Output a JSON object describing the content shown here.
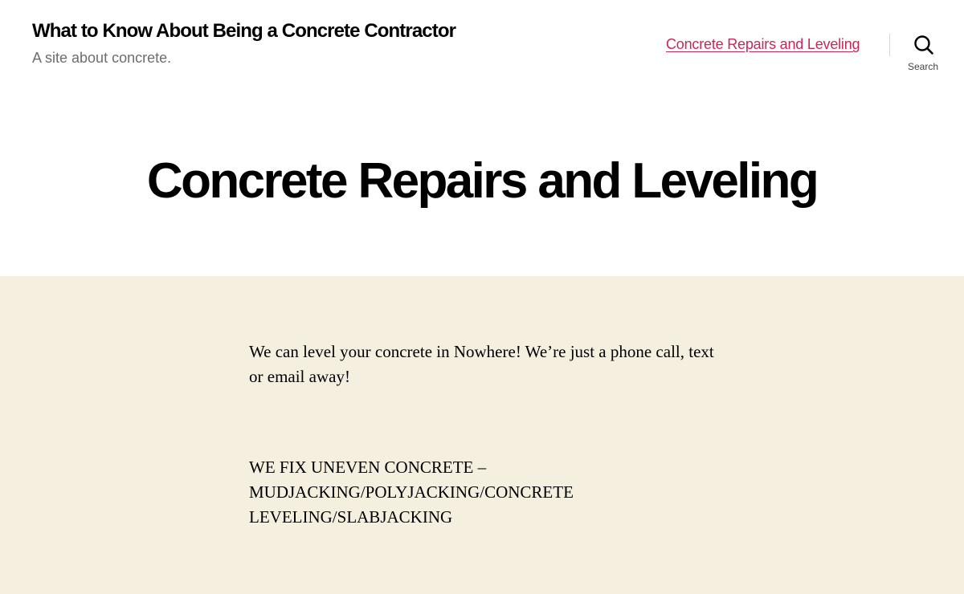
{
  "header": {
    "site_title": "What to Know About Being a Concrete Contractor",
    "site_description": "A site about concrete.",
    "nav": {
      "items": [
        {
          "label": "Concrete Repairs and Leveling"
        }
      ]
    },
    "search": {
      "icon": "search-icon",
      "label": "Search"
    }
  },
  "page": {
    "title": "Concrete Repairs and Leveling"
  },
  "content": {
    "paragraphs": [
      "We can level your concrete in Nowhere! We’re just a phone call, text or email away!",
      "WE FIX UNEVEN CONCRETE – MUDJACKING/POLYJACKING/CONCRETE LEVELING/SLABJACKING"
    ]
  },
  "colors": {
    "accent": "#cd2653",
    "content_background": "#f5efe0",
    "description_text": "#6d6d6d"
  }
}
